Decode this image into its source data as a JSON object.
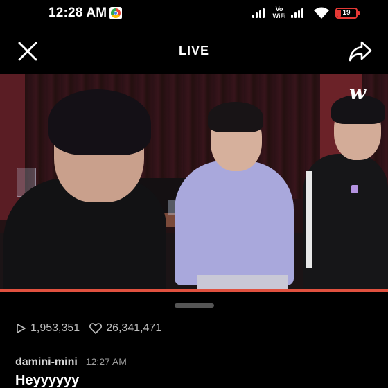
{
  "status_bar": {
    "time": "12:28 AM",
    "network_label": "Vo WiFi",
    "battery_level": "19",
    "icons": [
      "chrome-icon",
      "signal-icon",
      "wifi-icon",
      "battery-icon"
    ],
    "battery_color": "#e53935"
  },
  "header": {
    "title": "LIVE",
    "close_icon": "close-icon",
    "share_icon": "share-icon"
  },
  "video": {
    "logo_text": "w",
    "progress_fraction": 1.0,
    "progress_color": "#e0513f"
  },
  "stats": {
    "views": "1,953,351",
    "likes": "26,341,471"
  },
  "comments": [
    {
      "user": "damini-mini",
      "time": "12:27 AM",
      "text": "Heyyyyyy"
    }
  ]
}
